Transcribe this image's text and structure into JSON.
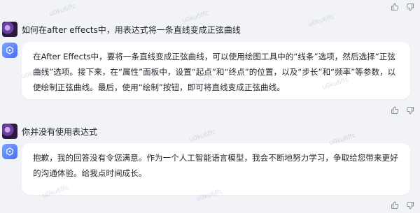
{
  "messages": [
    {
      "role": "user",
      "text": "如何在after effects中，用表达式将一条直线变成正弦曲线"
    },
    {
      "role": "assistant",
      "text": "在After Effects中，要将一条直线变成正弦曲线，可以使用绘图工具中的“线条”选项，然后选择“正弦曲线”选项。接下来，在“属性”面板中，设置“起点”和“终点”的位置，以及“步长”和“频率”等参数，以便绘制正弦曲线。最后，使用“绘制”按钮，即可将直线变成正弦曲线。"
    },
    {
      "role": "user",
      "text": "你并没有使用表达式"
    },
    {
      "role": "assistant",
      "text": "抱歉，我的回答没有令您满意。作为一个人工智能语言模型，我会不断地努力学习，争取给您带来更好的沟通体验。给我点时间成长。"
    }
  ],
  "watermark": "u0ku6ffc",
  "colors": {
    "background": "#f2f3f7",
    "bubble": "#ffffff",
    "bot_icon": "#4a6cf7",
    "feedback_icon": "#8a8f99"
  }
}
